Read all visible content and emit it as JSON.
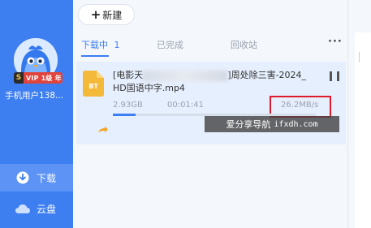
{
  "sidebar": {
    "vip_badge": "VIP 1级 年",
    "vip_letter": "S",
    "username": "手机用户138...",
    "nav": [
      {
        "label": "下载",
        "icon": "download-icon",
        "active": true
      },
      {
        "label": "云盘",
        "icon": "cloud-icon",
        "active": false
      }
    ]
  },
  "toolbar": {
    "new_label": "新建",
    "new_icon": "plus-icon",
    "more_label": "···"
  },
  "tabs": [
    {
      "label": "下载中",
      "count": "1",
      "active": true
    },
    {
      "label": "已完成",
      "active": false
    },
    {
      "label": "回收站",
      "active": false
    }
  ],
  "download": {
    "name_prefix": "[电影天",
    "name_suffix": "]周处除三害-2024_",
    "name_line2": "HD国语中字.mp4",
    "file_icon_label": "BT",
    "size": "2.93GB",
    "time": "00:01:41",
    "speed": "26.2MB/s",
    "progress": 0.11
  },
  "watermark": {
    "text": "爱分享导航",
    "url": "ifxdh.com"
  },
  "colors": {
    "accent": "#3d7ef1",
    "highlight": "#e11a2b",
    "row_bg": "#e6effd"
  }
}
